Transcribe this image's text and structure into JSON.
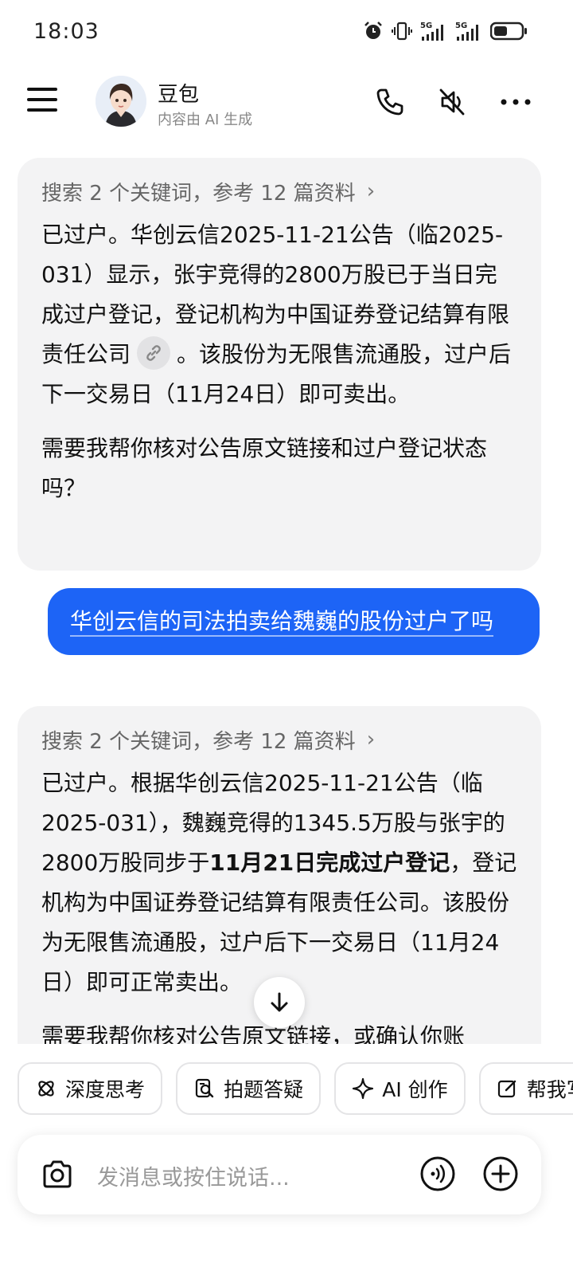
{
  "status_bar": {
    "time": "18:03",
    "net1": "5G",
    "net2": "5G"
  },
  "header": {
    "title": "豆包",
    "subtitle": "内容由 AI 生成"
  },
  "messages": {
    "ai1": {
      "search_summary": "搜索 2 个关键词，参考 12 篇资料",
      "p1_a": "已过户。华创云信2025-11-21公告（临2025-031）显示，张宇竞得的2800万股已于当日完成过户登记，登记机构为中国证券登记结算有限责任公司",
      "p1_b": "。该股份为无限售流通股，过户后下一交易日（11月24日）即可卖出。",
      "p2": "需要我帮你核对公告原文链接和过户登记状态吗？"
    },
    "user1": {
      "text": "华创云信的司法拍卖给魏巍的股份过户了吗"
    },
    "ai2": {
      "search_summary": "搜索 2 个关键词，参考 12 篇资料",
      "p1_a": "已过户。根据华创云信2025-11-21公告（临2025-031），魏巍竞得的1345.5万股与张宇的2800万股同步于",
      "p1_bold": "11月21日完成过户登记",
      "p1_c": "，登记机构为中国证券登记结算有限责任公司。该股份为无限售流通股，过户后下一交易日（11月24日）即可正常卖出。",
      "p2": "需要我帮你核对公告原文链接，或确认你账"
    }
  },
  "chips": [
    {
      "label": "深度思考",
      "icon": "atom-icon"
    },
    {
      "label": "拍题答疑",
      "icon": "photo-search-icon"
    },
    {
      "label": "AI 创作",
      "icon": "sparkle-icon"
    },
    {
      "label": "帮我写",
      "icon": "edit-icon"
    }
  ],
  "input": {
    "placeholder": "发消息或按住说话..."
  },
  "colors": {
    "user_bubble": "#1d64f6",
    "ai_bubble": "#f3f3f4"
  }
}
